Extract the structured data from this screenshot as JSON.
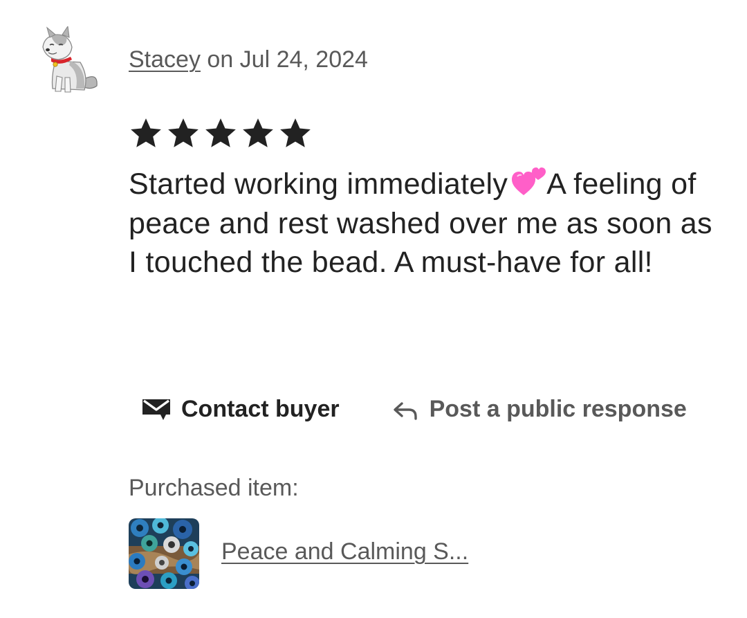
{
  "review": {
    "reviewer_name": "Stacey",
    "date_text": "on Jul 24, 2024",
    "rating": 5,
    "rating_max": 5,
    "text_part1": "Started working immediately",
    "text_part2": "A feeling of peace and rest washed over me as soon as I touched the bead. A must-have for all!",
    "inline_emoji": "two-hearts-icon",
    "star_color": "#222222",
    "heart_color": "#ff5fc8"
  },
  "actions": {
    "contact_label": "Contact buyer",
    "contact_icon": "envelope-icon",
    "response_label": "Post a public response",
    "response_icon": "reply-arrow-icon"
  },
  "purchase": {
    "label": "Purchased item:",
    "item_title": "Peace and Calming S..."
  },
  "avatar": {
    "icon": "husky-dog-avatar"
  }
}
